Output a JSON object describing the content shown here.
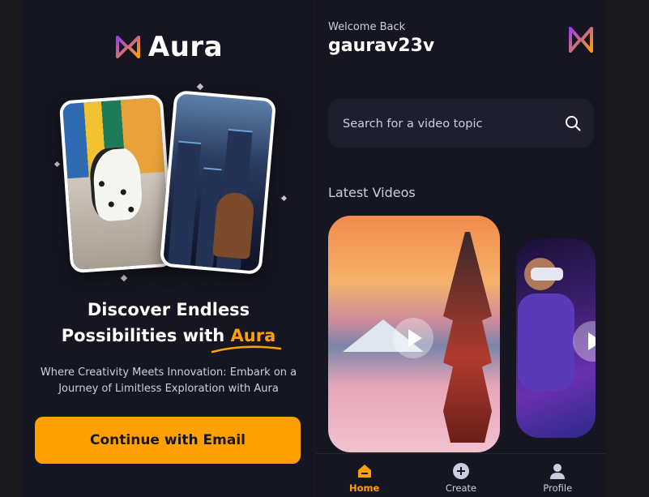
{
  "colors": {
    "background": "#161622",
    "accent": "#ffa001",
    "text_muted": "#cdcde0",
    "logo_purple": "#9b3cf0"
  },
  "onboarding": {
    "brand": "Aura",
    "logo_icon": "aura-logo-icon",
    "headline_line1": "Discover Endless",
    "headline_line2": "Possibilities with ",
    "headline_accent": "Aura",
    "subtext": "Where Creativity Meets Innovation: Embark on a Journey of Limitless Exploration with Aura",
    "cta_label": "Continue with Email"
  },
  "home": {
    "welcome": "Welcome Back",
    "username": "gaurav23v",
    "search": {
      "placeholder": "Search for a video topic",
      "icon": "search-icon"
    },
    "section_title": "Latest Videos",
    "videos": [
      {
        "thumbnail": "mount-fuji-pagoda",
        "icon": "play-icon"
      },
      {
        "thumbnail": "vr-headset-person",
        "icon": "play-icon"
      }
    ],
    "tabs": [
      {
        "label": "Home",
        "icon": "home-icon",
        "active": true
      },
      {
        "label": "Create",
        "icon": "plus-circle-icon",
        "active": false
      },
      {
        "label": "Profile",
        "icon": "profile-icon",
        "active": false
      }
    ]
  }
}
